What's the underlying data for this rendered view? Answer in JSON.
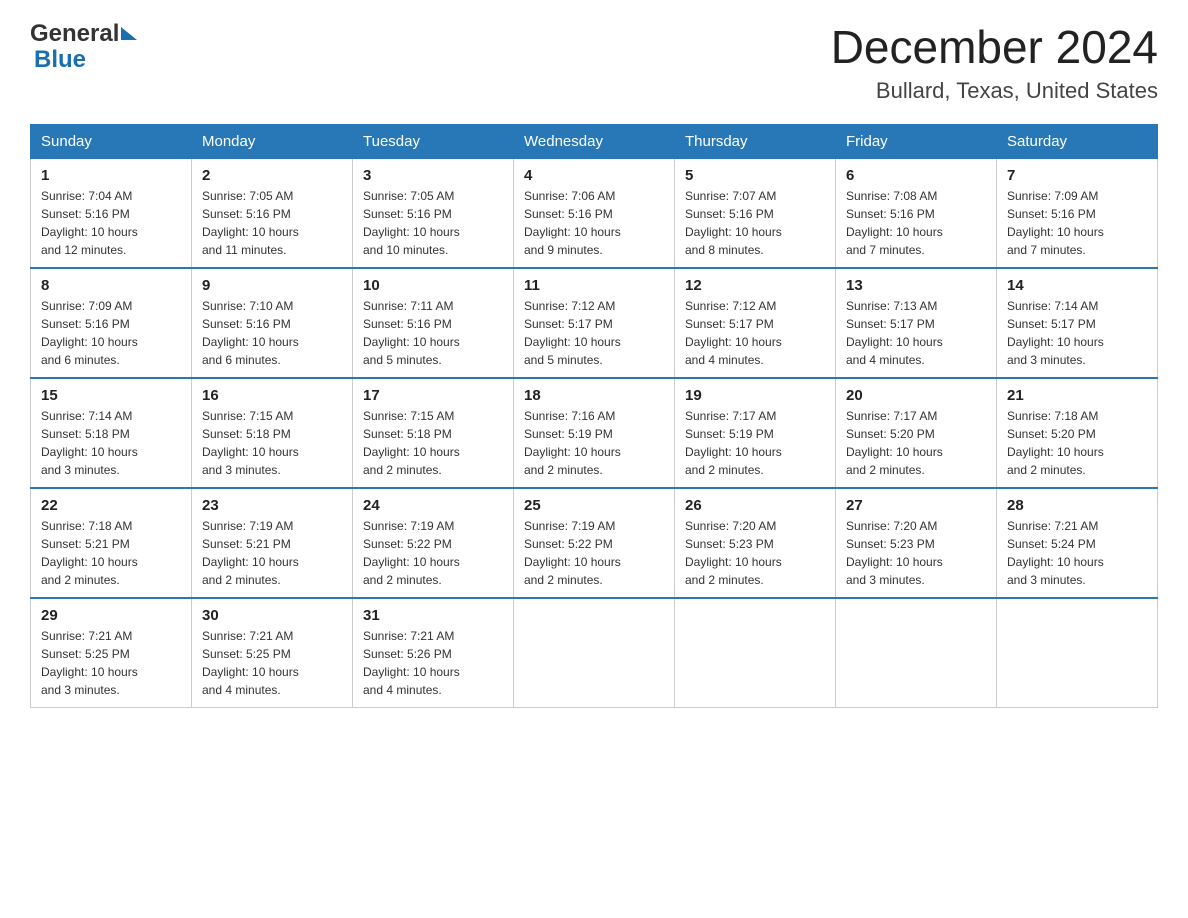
{
  "header": {
    "logo_general": "General",
    "logo_blue": "Blue",
    "title": "December 2024",
    "subtitle": "Bullard, Texas, United States"
  },
  "calendar": {
    "days_of_week": [
      "Sunday",
      "Monday",
      "Tuesday",
      "Wednesday",
      "Thursday",
      "Friday",
      "Saturday"
    ],
    "weeks": [
      [
        {
          "day": "1",
          "sunrise": "7:04 AM",
          "sunset": "5:16 PM",
          "daylight": "10 hours and 12 minutes."
        },
        {
          "day": "2",
          "sunrise": "7:05 AM",
          "sunset": "5:16 PM",
          "daylight": "10 hours and 11 minutes."
        },
        {
          "day": "3",
          "sunrise": "7:05 AM",
          "sunset": "5:16 PM",
          "daylight": "10 hours and 10 minutes."
        },
        {
          "day": "4",
          "sunrise": "7:06 AM",
          "sunset": "5:16 PM",
          "daylight": "10 hours and 9 minutes."
        },
        {
          "day": "5",
          "sunrise": "7:07 AM",
          "sunset": "5:16 PM",
          "daylight": "10 hours and 8 minutes."
        },
        {
          "day": "6",
          "sunrise": "7:08 AM",
          "sunset": "5:16 PM",
          "daylight": "10 hours and 7 minutes."
        },
        {
          "day": "7",
          "sunrise": "7:09 AM",
          "sunset": "5:16 PM",
          "daylight": "10 hours and 7 minutes."
        }
      ],
      [
        {
          "day": "8",
          "sunrise": "7:09 AM",
          "sunset": "5:16 PM",
          "daylight": "10 hours and 6 minutes."
        },
        {
          "day": "9",
          "sunrise": "7:10 AM",
          "sunset": "5:16 PM",
          "daylight": "10 hours and 6 minutes."
        },
        {
          "day": "10",
          "sunrise": "7:11 AM",
          "sunset": "5:16 PM",
          "daylight": "10 hours and 5 minutes."
        },
        {
          "day": "11",
          "sunrise": "7:12 AM",
          "sunset": "5:17 PM",
          "daylight": "10 hours and 5 minutes."
        },
        {
          "day": "12",
          "sunrise": "7:12 AM",
          "sunset": "5:17 PM",
          "daylight": "10 hours and 4 minutes."
        },
        {
          "day": "13",
          "sunrise": "7:13 AM",
          "sunset": "5:17 PM",
          "daylight": "10 hours and 4 minutes."
        },
        {
          "day": "14",
          "sunrise": "7:14 AM",
          "sunset": "5:17 PM",
          "daylight": "10 hours and 3 minutes."
        }
      ],
      [
        {
          "day": "15",
          "sunrise": "7:14 AM",
          "sunset": "5:18 PM",
          "daylight": "10 hours and 3 minutes."
        },
        {
          "day": "16",
          "sunrise": "7:15 AM",
          "sunset": "5:18 PM",
          "daylight": "10 hours and 3 minutes."
        },
        {
          "day": "17",
          "sunrise": "7:15 AM",
          "sunset": "5:18 PM",
          "daylight": "10 hours and 2 minutes."
        },
        {
          "day": "18",
          "sunrise": "7:16 AM",
          "sunset": "5:19 PM",
          "daylight": "10 hours and 2 minutes."
        },
        {
          "day": "19",
          "sunrise": "7:17 AM",
          "sunset": "5:19 PM",
          "daylight": "10 hours and 2 minutes."
        },
        {
          "day": "20",
          "sunrise": "7:17 AM",
          "sunset": "5:20 PM",
          "daylight": "10 hours and 2 minutes."
        },
        {
          "day": "21",
          "sunrise": "7:18 AM",
          "sunset": "5:20 PM",
          "daylight": "10 hours and 2 minutes."
        }
      ],
      [
        {
          "day": "22",
          "sunrise": "7:18 AM",
          "sunset": "5:21 PM",
          "daylight": "10 hours and 2 minutes."
        },
        {
          "day": "23",
          "sunrise": "7:19 AM",
          "sunset": "5:21 PM",
          "daylight": "10 hours and 2 minutes."
        },
        {
          "day": "24",
          "sunrise": "7:19 AM",
          "sunset": "5:22 PM",
          "daylight": "10 hours and 2 minutes."
        },
        {
          "day": "25",
          "sunrise": "7:19 AM",
          "sunset": "5:22 PM",
          "daylight": "10 hours and 2 minutes."
        },
        {
          "day": "26",
          "sunrise": "7:20 AM",
          "sunset": "5:23 PM",
          "daylight": "10 hours and 2 minutes."
        },
        {
          "day": "27",
          "sunrise": "7:20 AM",
          "sunset": "5:23 PM",
          "daylight": "10 hours and 3 minutes."
        },
        {
          "day": "28",
          "sunrise": "7:21 AM",
          "sunset": "5:24 PM",
          "daylight": "10 hours and 3 minutes."
        }
      ],
      [
        {
          "day": "29",
          "sunrise": "7:21 AM",
          "sunset": "5:25 PM",
          "daylight": "10 hours and 3 minutes."
        },
        {
          "day": "30",
          "sunrise": "7:21 AM",
          "sunset": "5:25 PM",
          "daylight": "10 hours and 4 minutes."
        },
        {
          "day": "31",
          "sunrise": "7:21 AM",
          "sunset": "5:26 PM",
          "daylight": "10 hours and 4 minutes."
        },
        null,
        null,
        null,
        null
      ]
    ],
    "sunrise_label": "Sunrise:",
    "sunset_label": "Sunset:",
    "daylight_label": "Daylight:"
  }
}
